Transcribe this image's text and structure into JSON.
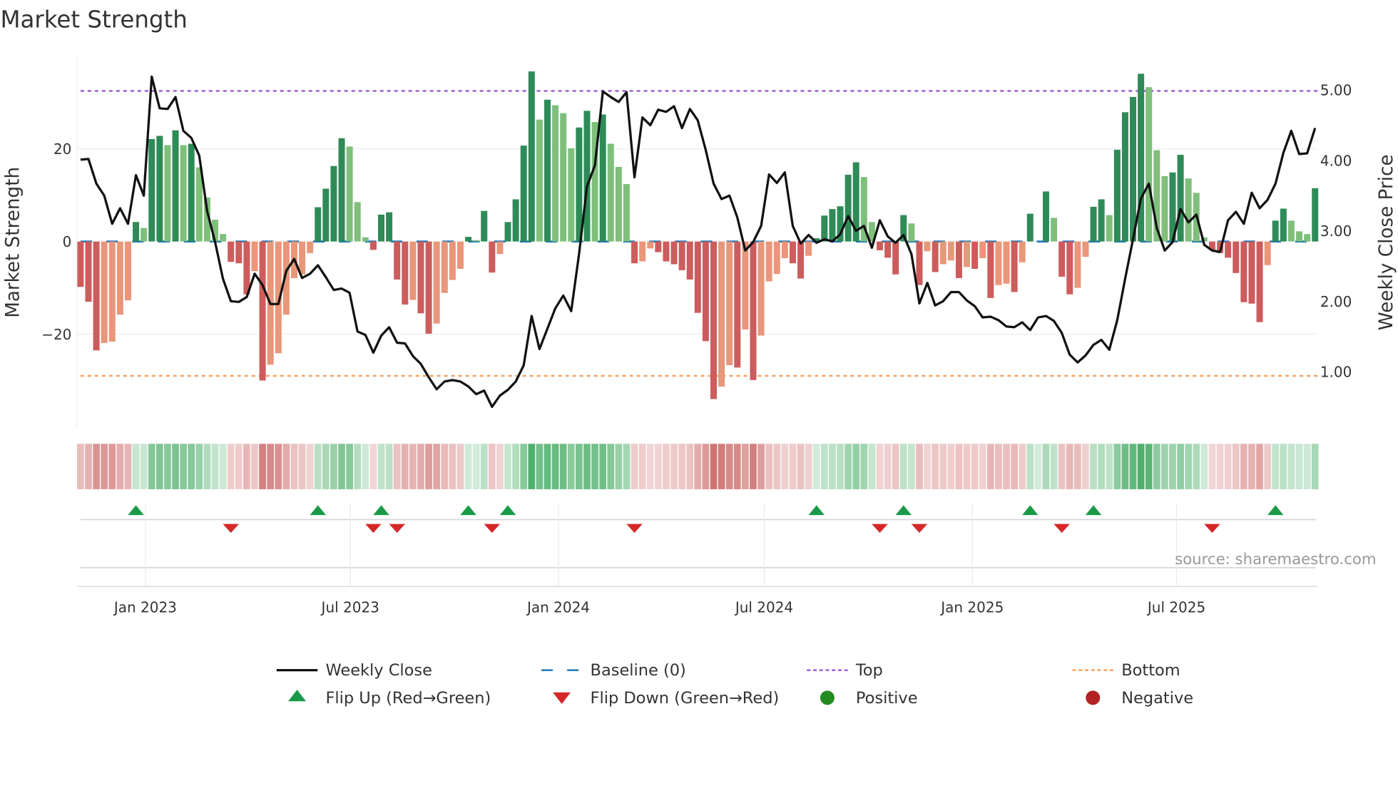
{
  "title": "Market Strength",
  "source": "source: sharemaestro.com",
  "colors": {
    "strong_up": "#2e8b57",
    "weak_up": "#7fbf7b",
    "strong_down": "#cd5c5c",
    "weak_down": "#e9967a",
    "price_line": "#111111",
    "baseline": "#1f77b4",
    "top": "#9b5fd6",
    "bottom": "#f4a261",
    "flip_up": "#1a9a48",
    "flip_down": "#d62728",
    "positive": "#228b22",
    "negative": "#b22222"
  },
  "legend": [
    {
      "key": "close",
      "label": "Weekly Close"
    },
    {
      "key": "baseline",
      "label": "Baseline (0)"
    },
    {
      "key": "top",
      "label": "Top"
    },
    {
      "key": "bottom",
      "label": "Bottom"
    },
    {
      "key": "flip_up",
      "label": "Flip Up (Red→Green)"
    },
    {
      "key": "flip_down",
      "label": "Flip Down (Green→Red)"
    },
    {
      "key": "positive",
      "label": "Positive"
    },
    {
      "key": "negative",
      "label": "Negative"
    }
  ],
  "chart_data": {
    "type": "bar",
    "title": "Market Strength",
    "xlabel": "",
    "ylabel": "Market Strength",
    "y2label": "Weekly Close Price",
    "ylim": [
      -40,
      40
    ],
    "y2lim": [
      0.36,
      5.63
    ],
    "grid": true,
    "legend_position": "bottom",
    "y_ticks": [
      {
        "value": 20,
        "label": "20"
      },
      {
        "value": 0,
        "label": "0"
      },
      {
        "value": -20,
        "label": "−20"
      }
    ],
    "y2_ticks": [
      {
        "value": 5,
        "label": "5.00"
      },
      {
        "value": 4,
        "label": "4.00"
      },
      {
        "value": 3,
        "label": "3.00"
      },
      {
        "value": 2,
        "label": "2.00"
      },
      {
        "value": 1,
        "label": "1.00"
      }
    ],
    "x_ticks": [
      {
        "week": 9.2,
        "label": "Jan 2023"
      },
      {
        "week": 35.1,
        "label": "Jul 2023"
      },
      {
        "week": 61.4,
        "label": "Jan 2024"
      },
      {
        "week": 87.4,
        "label": "Jul 2024"
      },
      {
        "week": 113.7,
        "label": "Jan 2025"
      },
      {
        "week": 139.5,
        "label": "Jul 2025"
      }
    ],
    "top_level": 32.5,
    "bottom_level": -29,
    "baseline": 0,
    "strength": [
      -9.8,
      -13,
      -23.5,
      -21.9,
      -21.6,
      -15.8,
      -12.7,
      4.2,
      2.9,
      22.1,
      22.8,
      20.8,
      24,
      20.8,
      21.1,
      16,
      9.5,
      4.7,
      1.6,
      -4.4,
      -4.7,
      -11.4,
      -6.4,
      -30,
      -26.6,
      -24.1,
      -15.8,
      -7.9,
      -7.1,
      -2.5,
      7.4,
      11.4,
      16.3,
      22.3,
      20.5,
      8.5,
      0.9,
      -1.8,
      5.8,
      6.3,
      -8.2,
      -13.6,
      -12.6,
      -15.5,
      -19.9,
      -17.7,
      -11.1,
      -8.3,
      -5.9,
      1.0,
      0.3,
      6.6,
      -6.7,
      -2.7,
      4.2,
      9.1,
      20.7,
      36.7,
      26.3,
      30.6,
      29.4,
      27.7,
      20.1,
      24.6,
      28.2,
      25.8,
      27.4,
      21.1,
      16.1,
      12.4,
      -4.7,
      -4.3,
      -1.5,
      -2.3,
      -4.3,
      -4.9,
      -6.2,
      -8.2,
      -15.4,
      -21.5,
      -34,
      -31.3,
      -26.7,
      -27.2,
      -19,
      -29.9,
      -20.3,
      -8.6,
      -7,
      -3.6,
      -4.7,
      -8,
      -3.1,
      0.7,
      5.6,
      7,
      7.6,
      14.4,
      17.1,
      13.9,
      4.2,
      -1.9,
      -3.5,
      -7.1,
      5.7,
      3.9,
      -9.4,
      -2.1,
      -6.6,
      -4.9,
      -4.1,
      -7.9,
      -5.5,
      -5.9,
      -3.6,
      -12.2,
      -9.4,
      -9.1,
      -10.9,
      -4.5,
      6.0,
      0,
      10.8,
      5.1,
      -7.6,
      -11.4,
      -10,
      -3.3,
      7.5,
      9.1,
      5.7,
      19.8,
      27.9,
      31.2,
      36.2,
      33.3,
      19.7,
      14.1,
      14.9,
      18.7,
      13.6,
      10.5,
      0.9,
      -1.8,
      -2.5,
      -3.5,
      -6.8,
      -13.1,
      -13.4,
      -17.4,
      -5.1,
      4.5,
      7.1,
      4.5,
      2.2,
      1.6,
      11.5
    ],
    "weekly_close": [
      4.01,
      4.02,
      3.67,
      3.5,
      3.1,
      3.32,
      3.1,
      3.79,
      3.5,
      5.19,
      4.74,
      4.73,
      4.9,
      4.42,
      4.32,
      4.07,
      3.28,
      2.84,
      2.32,
      2.0,
      1.99,
      2.06,
      2.39,
      2.23,
      1.96,
      1.96,
      2.43,
      2.6,
      2.33,
      2.39,
      2.51,
      2.34,
      2.16,
      2.18,
      2.12,
      1.57,
      1.52,
      1.27,
      1.51,
      1.63,
      1.41,
      1.4,
      1.22,
      1.11,
      0.92,
      0.75,
      0.86,
      0.88,
      0.86,
      0.79,
      0.68,
      0.73,
      0.5,
      0.66,
      0.74,
      0.86,
      1.09,
      1.79,
      1.32,
      1.61,
      1.9,
      2.08,
      1.86,
      2.67,
      3.63,
      3.93,
      4.98,
      4.9,
      4.83,
      4.97,
      3.76,
      4.61,
      4.5,
      4.72,
      4.69,
      4.77,
      4.46,
      4.73,
      4.57,
      4.15,
      3.67,
      3.45,
      3.5,
      3.19,
      2.72,
      2.84,
      3.07,
      3.8,
      3.68,
      3.83,
      3.07,
      2.82,
      2.94,
      2.83,
      2.88,
      2.85,
      2.95,
      3.21,
      3.0,
      3.07,
      2.76,
      3.15,
      2.92,
      2.83,
      2.94,
      2.67,
      1.97,
      2.26,
      1.94,
      2.0,
      2.13,
      2.13,
      2.01,
      1.93,
      1.77,
      1.78,
      1.73,
      1.64,
      1.63,
      1.7,
      1.59,
      1.77,
      1.79,
      1.72,
      1.55,
      1.24,
      1.13,
      1.23,
      1.38,
      1.45,
      1.31,
      1.73,
      2.32,
      2.88,
      3.46,
      3.67,
      3.04,
      2.72,
      2.84,
      3.31,
      3.12,
      3.23,
      2.8,
      2.72,
      2.7,
      3.15,
      3.27,
      3.1,
      3.54,
      3.32,
      3.44,
      3.67,
      4.11,
      4.42,
      4.09,
      4.1,
      4.46
    ]
  }
}
